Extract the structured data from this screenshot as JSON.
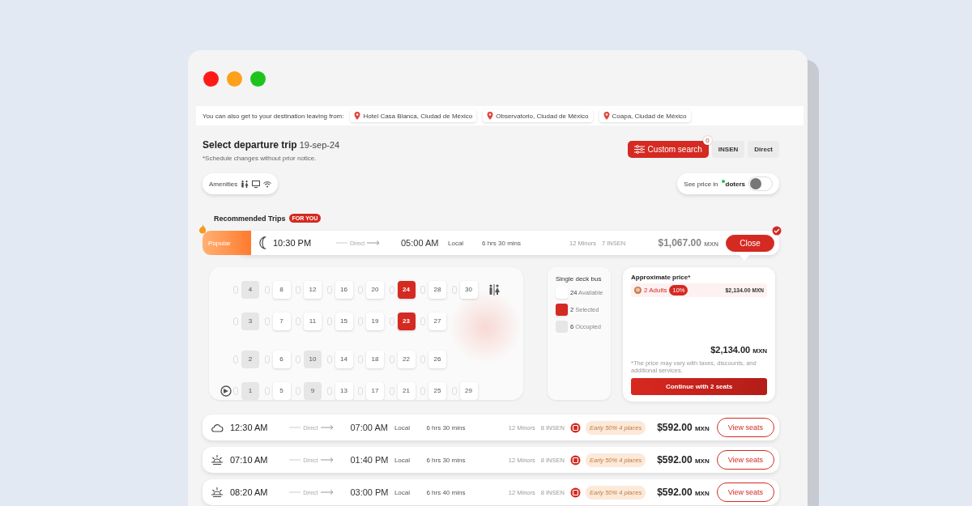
{
  "origins": {
    "label": "You can also get to your destination leaving from:",
    "places": [
      {
        "name": "Hotel Casa Blanca, Ciudad de México"
      },
      {
        "name": "Observatorio, Ciudad de México"
      },
      {
        "name": "Coapa, Ciudad de México"
      }
    ]
  },
  "header": {
    "title": "Select departure trip",
    "date": "19-sep-24",
    "note": "*Schedule changes without prior notice."
  },
  "filters": [
    {
      "label": "Custom search",
      "kind": "custom",
      "badge": "0",
      "selected": true
    },
    {
      "label": "INSEN",
      "kind": "plain",
      "selected": false
    },
    {
      "label": "Direct",
      "kind": "plain",
      "selected": false
    }
  ],
  "amenities": {
    "label": "Amenities"
  },
  "doters": {
    "label": "See price in",
    "brand": "doters",
    "on": false
  },
  "recommended": {
    "title": "Recommended Trips",
    "badge": "FOR YOU"
  },
  "trips": [
    {
      "tag": "Popular",
      "kind": "night",
      "depart": "10:30 PM",
      "route": "Direct",
      "arrive": "05:00 AM",
      "service": "Local",
      "duration": "6 hrs 30 mins",
      "minors": "12 Minors",
      "insen": "7 INSEN",
      "price": "$1,067.00",
      "currency": "MXN",
      "action": "Close",
      "expanded": true
    },
    {
      "kind": "cloudy",
      "depart": "12:30 AM",
      "route": "Direct",
      "arrive": "07:00 AM",
      "service": "Local",
      "duration": "6 hrs 30 mins",
      "minors": "12 Minors",
      "insen": "8 INSEN",
      "promo": "Early 50% 4 places",
      "price": "$592.00",
      "currency": "MXN",
      "action": "View seats",
      "expanded": false
    },
    {
      "kind": "sunrise",
      "depart": "07:10 AM",
      "route": "Direct",
      "arrive": "01:40 PM",
      "service": "Local",
      "duration": "6 hrs 30 mins",
      "minors": "12 Minors",
      "insen": "8 INSEN",
      "promo": "Early 50% 4 places",
      "price": "$592.00",
      "currency": "MXN",
      "action": "View seats",
      "expanded": false
    },
    {
      "kind": "sunrise",
      "depart": "08:20 AM",
      "route": "Direct",
      "arrive": "03:00 PM",
      "service": "Local",
      "duration": "6 hrs 40 mins",
      "minors": "12 Minors",
      "insen": "8 INSEN",
      "promo": "Early 50% 4 places",
      "price": "$592.00",
      "currency": "MXN",
      "action": "View seats",
      "expanded": false
    }
  ],
  "seat_map": {
    "rows": [
      {
        "seats": [
          {
            "number": "4",
            "occupied": true,
            "selected": false
          },
          {
            "number": "8",
            "occupied": false,
            "selected": false
          },
          {
            "number": "12",
            "occupied": false,
            "selected": false
          },
          {
            "number": "16",
            "occupied": false,
            "selected": false
          },
          {
            "number": "20",
            "occupied": false,
            "selected": false
          },
          {
            "number": "24",
            "occupied": false,
            "selected": true
          },
          {
            "number": "28",
            "occupied": false,
            "selected": false
          },
          {
            "number": "30",
            "occupied": false,
            "selected": false
          }
        ]
      },
      {
        "seats": [
          {
            "number": "3",
            "occupied": true,
            "selected": false
          },
          {
            "number": "7",
            "occupied": false,
            "selected": false
          },
          {
            "number": "11",
            "occupied": false,
            "selected": false
          },
          {
            "number": "15",
            "occupied": false,
            "selected": false
          },
          {
            "number": "19",
            "occupied": false,
            "selected": false
          },
          {
            "number": "23",
            "occupied": false,
            "selected": true
          },
          {
            "number": "27",
            "occupied": false,
            "selected": false
          }
        ]
      },
      {
        "seats": [
          {
            "number": "2",
            "occupied": true,
            "selected": false
          },
          {
            "number": "6",
            "occupied": false,
            "selected": false
          },
          {
            "number": "10",
            "occupied": true,
            "selected": false
          },
          {
            "number": "14",
            "occupied": false,
            "selected": false
          },
          {
            "number": "18",
            "occupied": false,
            "selected": false
          },
          {
            "number": "22",
            "occupied": false,
            "selected": false
          },
          {
            "number": "26",
            "occupied": false,
            "selected": false
          }
        ]
      },
      {
        "seats": [
          {
            "number": "1",
            "occupied": true,
            "selected": false
          },
          {
            "number": "5",
            "occupied": false,
            "selected": false
          },
          {
            "number": "9",
            "occupied": true,
            "selected": false
          },
          {
            "number": "13",
            "occupied": false,
            "selected": false
          },
          {
            "number": "17",
            "occupied": false,
            "selected": false
          },
          {
            "number": "21",
            "occupied": false,
            "selected": false
          },
          {
            "number": "25",
            "occupied": false,
            "selected": false
          },
          {
            "number": "29",
            "occupied": false,
            "selected": false
          }
        ]
      }
    ]
  },
  "legend": {
    "title": "Single deck bus",
    "items": [
      {
        "count": "24",
        "label": "Available",
        "kind": "available"
      },
      {
        "count": "2",
        "label": "Selected",
        "kind": "selected"
      },
      {
        "count": "6",
        "label": "Occupied",
        "kind": "occupied"
      }
    ]
  },
  "price": {
    "title": "Approximate price*",
    "passengers": "2 Adults",
    "discount": "10%",
    "subtotal": "$2,134.00",
    "subtotal_currency": "MXN",
    "total": "$2,134.00",
    "total_currency": "MXN",
    "note": "*The price may vary with taxes, discounts, and additional services.",
    "action": "Continue with 2 seats"
  }
}
